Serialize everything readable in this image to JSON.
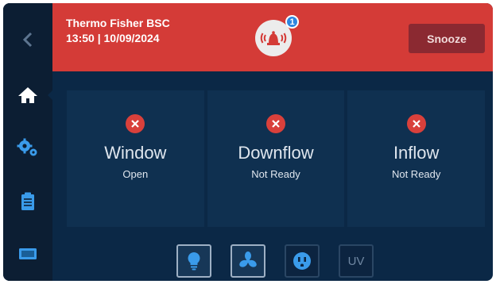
{
  "header": {
    "title": "Thermo Fisher BSC",
    "datetime": "13:50 | 10/09/2024",
    "alarm_icon": "bell-alarm-icon",
    "alarm_count": "1",
    "snooze_label": "Snooze",
    "color": "#d43b37"
  },
  "sidebar": {
    "items": [
      {
        "icon": "back-chevron-icon"
      },
      {
        "icon": "home-icon",
        "active": true
      },
      {
        "icon": "settings-gears-icon"
      },
      {
        "icon": "clipboard-icon"
      },
      {
        "icon": "display-icon"
      }
    ]
  },
  "status_cards": [
    {
      "title": "Window",
      "status": "Open",
      "icon": "error-x-icon"
    },
    {
      "title": "Downflow",
      "status": "Not Ready",
      "icon": "error-x-icon"
    },
    {
      "title": "Inflow",
      "status": "Not Ready",
      "icon": "error-x-icon"
    }
  ],
  "controls": [
    {
      "name": "light",
      "icon": "lightbulb-icon",
      "state": "on"
    },
    {
      "name": "fan",
      "icon": "fan-icon",
      "state": "on"
    },
    {
      "name": "outlet",
      "icon": "power-outlet-icon",
      "state": "off"
    },
    {
      "name": "uv",
      "label": "UV",
      "state": "off"
    }
  ],
  "colors": {
    "background": "#0b2846",
    "sidebar": "#0c1e33",
    "error": "#d9403b",
    "accent_blue": "#3a9bea"
  }
}
